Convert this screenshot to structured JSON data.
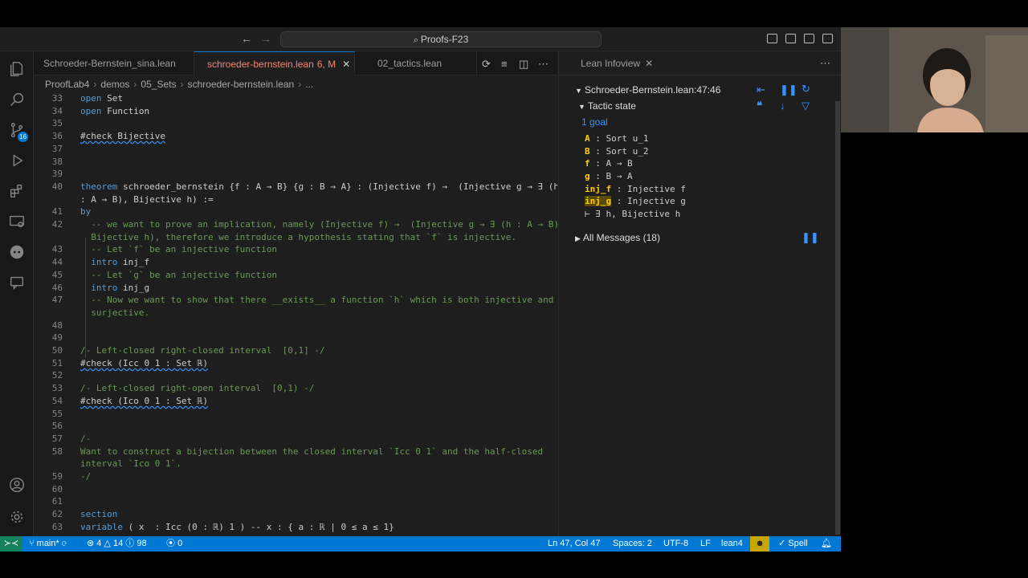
{
  "window": {
    "command_center": "Proofs-F23"
  },
  "activity": {
    "scm_badge": "16"
  },
  "tabs": [
    {
      "label": "Schroeder-Bernstein_sina.lean",
      "modified": ""
    },
    {
      "label": "schroeder-bernstein.lean",
      "modified": "6, M"
    },
    {
      "label": "02_tactics.lean",
      "modified": ""
    }
  ],
  "breadcrumb": [
    "ProofLab4",
    "demos",
    "05_Sets",
    "schroeder-bernstein.lean",
    "..."
  ],
  "editor": {
    "lines": [
      {
        "n": "33",
        "text": "open Set"
      },
      {
        "n": "34",
        "text": "open Function"
      },
      {
        "n": "35",
        "text": ""
      },
      {
        "n": "36",
        "text": "#check Bijective"
      },
      {
        "n": "37",
        "text": ""
      },
      {
        "n": "38",
        "text": ""
      },
      {
        "n": "39",
        "text": ""
      },
      {
        "n": "40",
        "text": "theorem schroeder_bernstein {f : A → B} {g : B → A} : (Injective f) →  (Injective g → ∃ (h",
        "wrap": ": A → B), Bijective h) :="
      },
      {
        "n": "41",
        "text": "by"
      },
      {
        "n": "42",
        "text": "  -- we want to prove an implication, namely (Injective f) →  (Injective g → ∃ (h : A → B),",
        "wrap": "  Bijective h), therefore we introduce a hypothesis stating that `f` is injective."
      },
      {
        "n": "43",
        "text": "  -- Let `f` be an injective function"
      },
      {
        "n": "44",
        "text": "  intro inj_f"
      },
      {
        "n": "45",
        "text": "  -- Let `g` be an injective function"
      },
      {
        "n": "46",
        "text": "  intro inj_g"
      },
      {
        "n": "47",
        "text": "  -- Now we want to show that there __exists__ a function `h` which is both injective and",
        "wrap": "  surjective."
      },
      {
        "n": "48",
        "text": ""
      },
      {
        "n": "49",
        "text": ""
      },
      {
        "n": "50",
        "text": "/- Left-closed right-closed interval  [0,1] -/"
      },
      {
        "n": "51",
        "text": "#check (Icc 0 1 : Set ℝ)"
      },
      {
        "n": "52",
        "text": ""
      },
      {
        "n": "53",
        "text": "/- Left-closed right-open interval  [0,1) -/"
      },
      {
        "n": "54",
        "text": "#check (Ico 0 1 : Set ℝ)"
      },
      {
        "n": "55",
        "text": ""
      },
      {
        "n": "56",
        "text": ""
      },
      {
        "n": "57",
        "text": "/-"
      },
      {
        "n": "58",
        "text": "Want to construct a bijection between the closed interval `Icc 0 1` and the half-closed",
        "wrap": "interval `Ico 0 1`."
      },
      {
        "n": "59",
        "text": "-/"
      },
      {
        "n": "60",
        "text": ""
      },
      {
        "n": "61",
        "text": ""
      },
      {
        "n": "62",
        "text": "section"
      },
      {
        "n": "63",
        "text": "variable ( x  : Icc (0 : ℝ) 1 ) -- x : { a : ℝ | 0 ≤ a ≤ 1}"
      }
    ]
  },
  "infoview": {
    "panel_title": "Lean Infoview",
    "location": "Schroeder-Bernstein.lean:47:46",
    "tactic_state": "Tactic state",
    "goal_count": "1 goal",
    "hypotheses": [
      {
        "name": "A",
        "type": "Sort u_1"
      },
      {
        "name": "B",
        "type": "Sort u_2"
      },
      {
        "name": "f",
        "type": "A → B"
      },
      {
        "name": "g",
        "type": "B → A"
      },
      {
        "name": "inj_f",
        "type": "Injective f"
      },
      {
        "name": "inj_g",
        "type": "Injective g"
      }
    ],
    "goal": "⊢ ∃ h, Bijective h",
    "all_messages": "All Messages (18)"
  },
  "status": {
    "branch": "main*",
    "errors": "4",
    "warnings": "14",
    "infos": "98",
    "ports": "0",
    "position": "Ln 47, Col 47",
    "spaces": "Spaces: 2",
    "encoding": "UTF-8",
    "eol": "LF",
    "language": "lean4",
    "spell": "Spell"
  },
  "colors": {
    "statusbar": "#0078d4",
    "remote": "#16825d",
    "keyword": "#569cd6",
    "comment": "#6a9955",
    "hypothesis_name": "#ffcc00"
  }
}
